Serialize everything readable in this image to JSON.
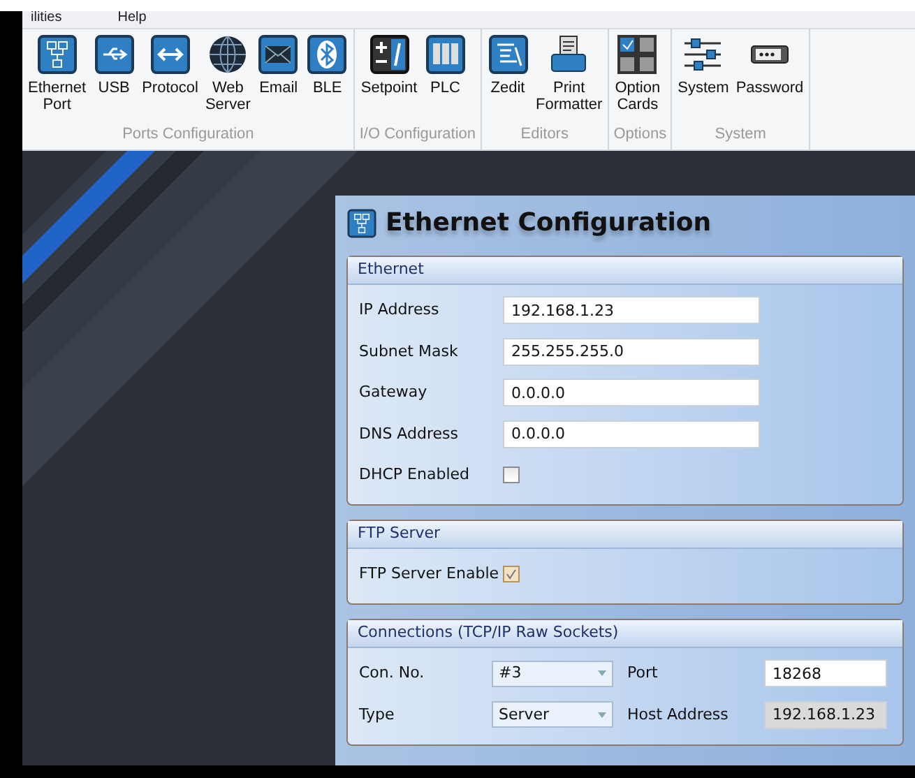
{
  "menu": [
    "ilities",
    "Help"
  ],
  "ribbon": [
    {
      "group": "Ports Configuration",
      "items": [
        "Ethernet\nPort",
        "USB",
        "Protocol",
        "Web\nServer",
        "Email",
        "BLE"
      ]
    },
    {
      "group": "I/O Configuration",
      "items": [
        "Setpoint",
        "PLC"
      ]
    },
    {
      "group": "Editors",
      "items": [
        "Zedit",
        "Print\nFormatter"
      ]
    },
    {
      "group": "Options",
      "items": [
        "Option\nCards"
      ]
    },
    {
      "group": "System",
      "items": [
        "System",
        "Password"
      ]
    }
  ],
  "panel": {
    "title": "Ethernet Configuration",
    "ethernet": {
      "title": "Ethernet",
      "fields": [
        {
          "label": "IP Address",
          "value": "192.168.1.23"
        },
        {
          "label": "Subnet Mask",
          "value": "255.255.255.0"
        },
        {
          "label": "Gateway",
          "value": "0.0.0.0"
        },
        {
          "label": "DNS Address",
          "value": "0.0.0.0"
        }
      ],
      "dhcp": {
        "label": "DHCP Enabled",
        "checked": false
      }
    },
    "ftp": {
      "title": "FTP Server",
      "enable": {
        "label": "FTP Server Enable",
        "checked": true
      }
    },
    "connections": {
      "title": "Connections (TCP/IP Raw Sockets)",
      "rows": [
        {
          "label": "Con. No.",
          "select": "#3",
          "label2": "Port",
          "value": "18268",
          "disabled": false
        },
        {
          "label": "Type",
          "select": "Server",
          "label2": "Host Address",
          "value": "192.168.1.23",
          "disabled": true
        }
      ]
    }
  }
}
